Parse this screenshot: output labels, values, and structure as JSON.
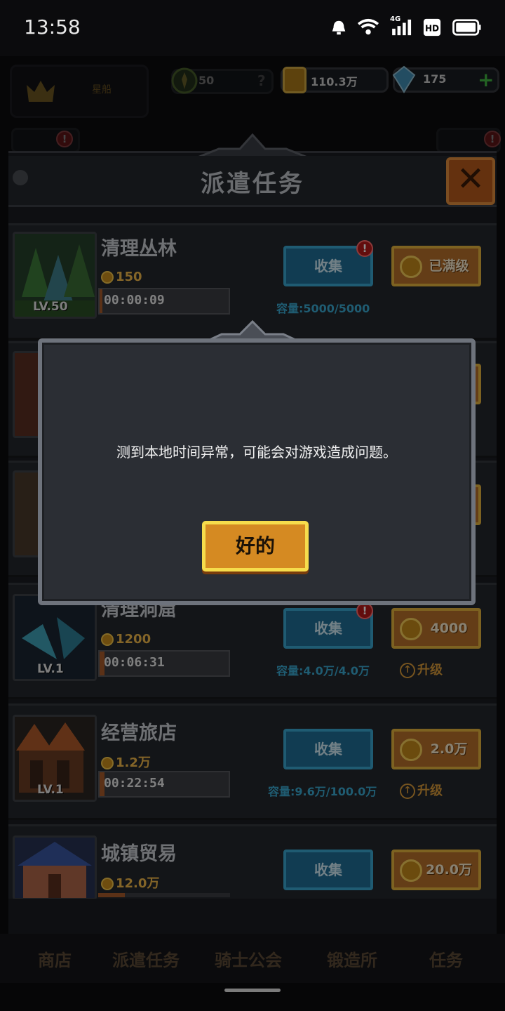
{
  "status_bar": {
    "time": "13:58",
    "network": "4G"
  },
  "resources": {
    "player_name": "星船",
    "stamina": "50",
    "gold": "110.3万",
    "gems": "175"
  },
  "panel": {
    "title": "派遣任务"
  },
  "tasks": [
    {
      "name": "清理丛林",
      "level": "LV.50",
      "cost": "150",
      "timer": "00:00:09",
      "progress": 0.02,
      "collect_label": "收集",
      "has_alert": true,
      "upgrade_label": "已满级",
      "capacity": "容量:5000/5000",
      "upgrade_text": ""
    },
    {
      "name": "清理洞窟",
      "level": "LV.1",
      "cost": "1200",
      "timer": "00:06:31",
      "progress": 0.04,
      "collect_label": "收集",
      "has_alert": true,
      "upgrade_label": "4000",
      "capacity": "容量:4.0万/4.0万",
      "upgrade_text": "升级"
    },
    {
      "name": "经营旅店",
      "level": "LV.1",
      "cost": "1.2万",
      "timer": "00:22:54",
      "progress": 0.04,
      "collect_label": "收集",
      "has_alert": false,
      "upgrade_label": "2.0万",
      "capacity": "容量:9.6万/100.0万",
      "upgrade_text": "升级"
    },
    {
      "name": "城镇贸易",
      "level": "",
      "cost": "12.0万",
      "timer": "",
      "progress": 0.2,
      "collect_label": "收集",
      "has_alert": false,
      "upgrade_label": "20.0万",
      "capacity": "",
      "upgrade_text": ""
    }
  ],
  "bottom_nav": [
    "商店",
    "派遣任务",
    "骑士公会",
    "锻造所",
    "任务"
  ],
  "dialog": {
    "message": "测到本地时间异常，可能会对游戏造成问题。",
    "ok_label": "好的"
  },
  "colors": {
    "accent_gold": "#e3b23c",
    "collect_blue": "#1f6e96",
    "close_orange": "#b65a1d"
  }
}
